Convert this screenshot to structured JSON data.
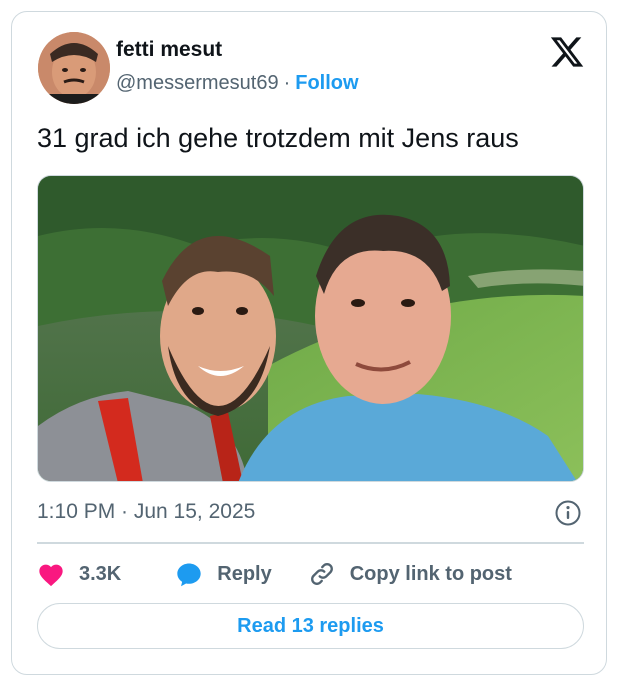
{
  "author": {
    "display_name": "fetti mesut",
    "handle": "@messermesut69",
    "separator": "·",
    "follow_label": "Follow"
  },
  "tweet": {
    "text": "31 grad ich gehe trotzdem mit Jens raus",
    "timestamp": "1:10 PM · Jun 15, 2025"
  },
  "actions": {
    "like_count": "3.3K",
    "reply_label": "Reply",
    "copy_link_label": "Copy link to post"
  },
  "read_replies_label": "Read 13 replies",
  "colors": {
    "accent": "#1d9bf0",
    "like": "#f91880",
    "muted_text": "#536471",
    "border": "#cfd9de"
  },
  "icons": [
    "x-logo-icon",
    "info-icon",
    "heart-icon",
    "reply-bubble-icon",
    "link-icon"
  ]
}
